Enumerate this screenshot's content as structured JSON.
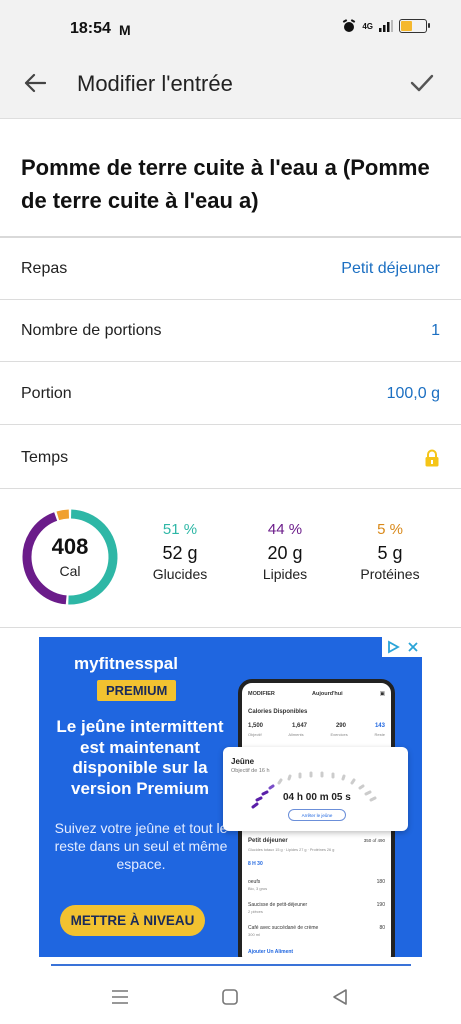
{
  "status": {
    "time": "18:54",
    "mail_icon": "M",
    "network": "4G",
    "battery_level": 0.45,
    "battery_color": "#f5b82e"
  },
  "app_bar": {
    "back_icon": "arrow-left-icon",
    "title": "Modifier l'entrée",
    "save_icon": "check-icon"
  },
  "food": {
    "title": "Pomme de terre cuite à l'eau a (Pomme de terre cuite à l'eau a)"
  },
  "fields": [
    {
      "label": "Repas",
      "value": "Petit déjeuner"
    },
    {
      "label": "Nombre de portions",
      "value": "1"
    },
    {
      "label": "Portion",
      "value": "100,0 g"
    },
    {
      "label": "Temps",
      "value": ""
    }
  ],
  "colors": {
    "accent_blue": "#1b6fc2",
    "carbs": "#2eb7a6",
    "fat": "#6b1c8a",
    "protein": "#f0a030",
    "lock": "#f5c518"
  },
  "nutrition": {
    "calories": "408",
    "calories_unit": "Cal",
    "macros": [
      {
        "pct": "51 %",
        "value": "52 g",
        "name": "Glucides",
        "fraction": 0.51
      },
      {
        "pct": "44 %",
        "value": "20 g",
        "name": "Lipides",
        "fraction": 0.44
      },
      {
        "pct": "5 %",
        "value": "5 g",
        "name": "Protéines",
        "fraction": 0.05
      }
    ]
  },
  "ad": {
    "brand": "myfitnesspal",
    "badge": "PREMIUM",
    "headline": "Le jeûne intermittent est maintenant disponible sur la version Premium",
    "subtext": "Suivez votre jeûne et tout le reste dans un seul et même espace.",
    "cta": "METTRE À NIVEAU",
    "phone": {
      "header_left": "MODIFIER",
      "header_center": "Aujourd'hui",
      "calories_title": "Calories Disponibles",
      "cal_values": [
        "1,500",
        "1,647",
        "290",
        "143"
      ],
      "cal_labels": [
        "Objectif",
        "Aliments",
        "Exercices",
        "Reste"
      ],
      "fast_title": "Jeûne",
      "fast_subtitle": "Objectif de 16 h",
      "fast_timer": "04 h 00 m 05 s",
      "fast_button": "Arrêter le jeûne",
      "meal_title": "Petit déjeuner",
      "meal_total": "350 of 490",
      "meal_sub": "Glucides totaux 15 g · Lipides 27 g · Protéines 26 g",
      "meal_time": "8 H 30",
      "items": [
        {
          "name": "oeufs",
          "detail": "Bio, 3 gros",
          "cal": "180"
        },
        {
          "name": "Saucisse de petit-déjeuner",
          "detail": "2 pièces",
          "cal": "190"
        },
        {
          "name": "Café avec succédané de crème",
          "detail": "300 ml",
          "cal": "80"
        }
      ],
      "add_food": "Ajouter Un Aliment"
    }
  },
  "nav": {
    "menu_icon": "menu-icon",
    "home_icon": "home-square-icon",
    "back_icon": "back-triangle-icon"
  }
}
